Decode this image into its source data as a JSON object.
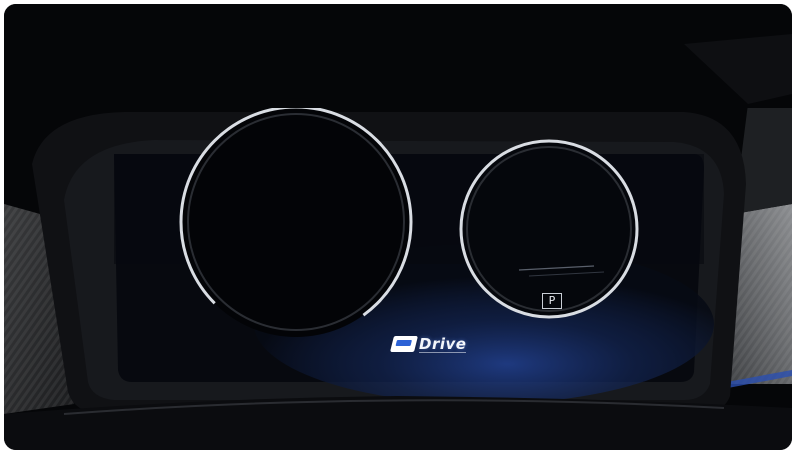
{
  "photo": {
    "subject": "",
    "gear_indicator": "P",
    "drive_badge": {
      "icon": "e-badge-icon",
      "text": "Drive"
    }
  },
  "colors": {
    "background": "#050608",
    "bezel": "#17191d",
    "ring": "#d9dde3",
    "screen_glow": "#1f3f8f",
    "accent_blue": "#2c62d6"
  }
}
